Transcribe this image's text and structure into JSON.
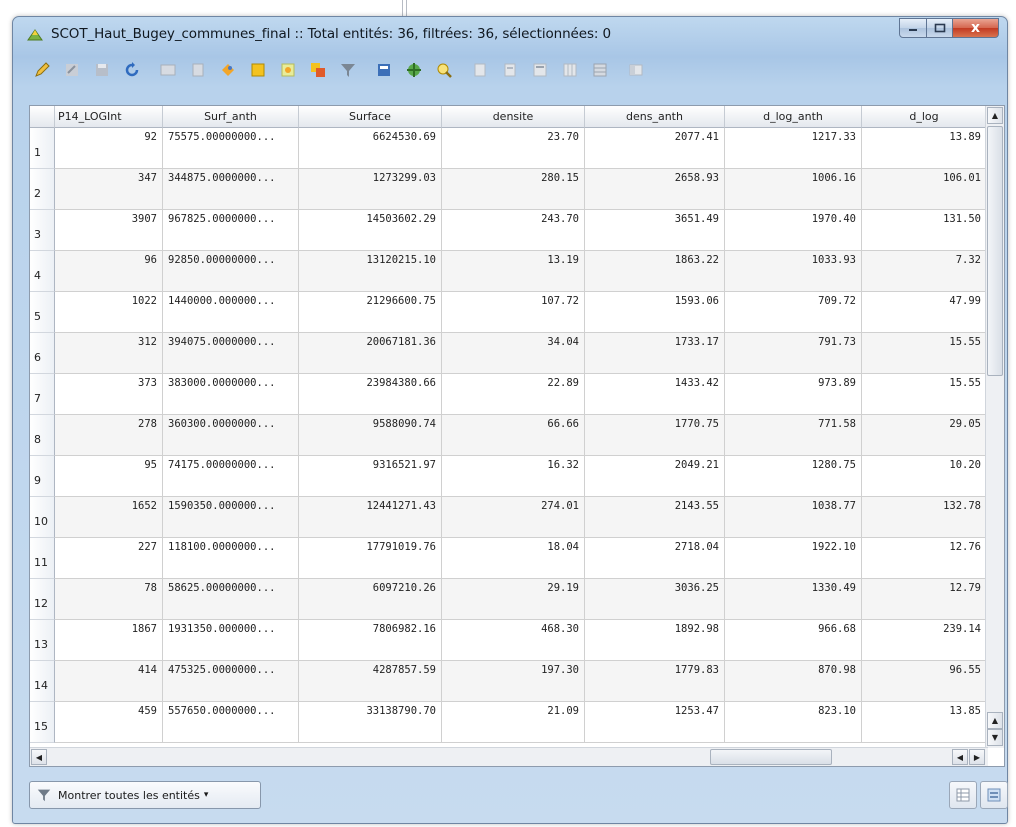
{
  "window": {
    "title": "SCOT_Haut_Bugey_communes_final :: Total entités: 36, filtrées: 36, sélectionnées: 0",
    "close_glyph": "x"
  },
  "toolbar": {
    "icons": [
      "pencil-icon",
      "toggle-edit-icon",
      "save-icon",
      "reload-icon",
      "add-feature-icon",
      "delete-feature-icon",
      "cut-icon",
      "copy-icon",
      "paste-icon",
      "select-by-expression-icon",
      "filter-icon",
      "move-selection-top-icon",
      "pan-to-selection-icon",
      "zoom-to-selection-icon",
      "new-field-icon",
      "delete-field-icon",
      "field-calculator-icon",
      "organize-columns-icon",
      "conditional-formatting-icon",
      "dock-icon"
    ]
  },
  "table": {
    "columns": [
      "P14_LOGInt",
      "Surf_anth",
      "Surface",
      "densite",
      "dens_anth",
      "d_log_anth",
      "d_log"
    ],
    "rows": [
      {
        "id": "1",
        "cells": [
          "92",
          "75575.00000000...",
          "6624530.69",
          "23.70",
          "2077.41",
          "1217.33",
          "13.89"
        ]
      },
      {
        "id": "2",
        "cells": [
          "347",
          "344875.0000000...",
          "1273299.03",
          "280.15",
          "2658.93",
          "1006.16",
          "106.01"
        ]
      },
      {
        "id": "3",
        "cells": [
          "3907",
          "967825.0000000...",
          "14503602.29",
          "243.70",
          "3651.49",
          "1970.40",
          "131.50"
        ]
      },
      {
        "id": "4",
        "cells": [
          "96",
          "92850.00000000...",
          "13120215.10",
          "13.19",
          "1863.22",
          "1033.93",
          "7.32"
        ]
      },
      {
        "id": "5",
        "cells": [
          "1022",
          "1440000.000000...",
          "21296600.75",
          "107.72",
          "1593.06",
          "709.72",
          "47.99"
        ]
      },
      {
        "id": "6",
        "cells": [
          "312",
          "394075.0000000...",
          "20067181.36",
          "34.04",
          "1733.17",
          "791.73",
          "15.55"
        ]
      },
      {
        "id": "7",
        "cells": [
          "373",
          "383000.0000000...",
          "23984380.66",
          "22.89",
          "1433.42",
          "973.89",
          "15.55"
        ]
      },
      {
        "id": "8",
        "cells": [
          "278",
          "360300.0000000...",
          "9588090.74",
          "66.66",
          "1770.75",
          "771.58",
          "29.05"
        ]
      },
      {
        "id": "9",
        "cells": [
          "95",
          "74175.00000000...",
          "9316521.97",
          "16.32",
          "2049.21",
          "1280.75",
          "10.20"
        ]
      },
      {
        "id": "10",
        "cells": [
          "1652",
          "1590350.000000...",
          "12441271.43",
          "274.01",
          "2143.55",
          "1038.77",
          "132.78"
        ]
      },
      {
        "id": "11",
        "cells": [
          "227",
          "118100.0000000...",
          "17791019.76",
          "18.04",
          "2718.04",
          "1922.10",
          "12.76"
        ]
      },
      {
        "id": "12",
        "cells": [
          "78",
          "58625.00000000...",
          "6097210.26",
          "29.19",
          "3036.25",
          "1330.49",
          "12.79"
        ]
      },
      {
        "id": "13",
        "cells": [
          "1867",
          "1931350.000000...",
          "7806982.16",
          "468.30",
          "1892.98",
          "966.68",
          "239.14"
        ]
      },
      {
        "id": "14",
        "cells": [
          "414",
          "475325.0000000...",
          "4287857.59",
          "197.30",
          "1779.83",
          "870.98",
          "96.55"
        ]
      },
      {
        "id": "15",
        "cells": [
          "459",
          "557650.0000000...",
          "33138790.70",
          "21.09",
          "1253.47",
          "823.10",
          "13.85"
        ]
      }
    ]
  },
  "footer": {
    "filter_label": "Montrer toutes les entités"
  }
}
